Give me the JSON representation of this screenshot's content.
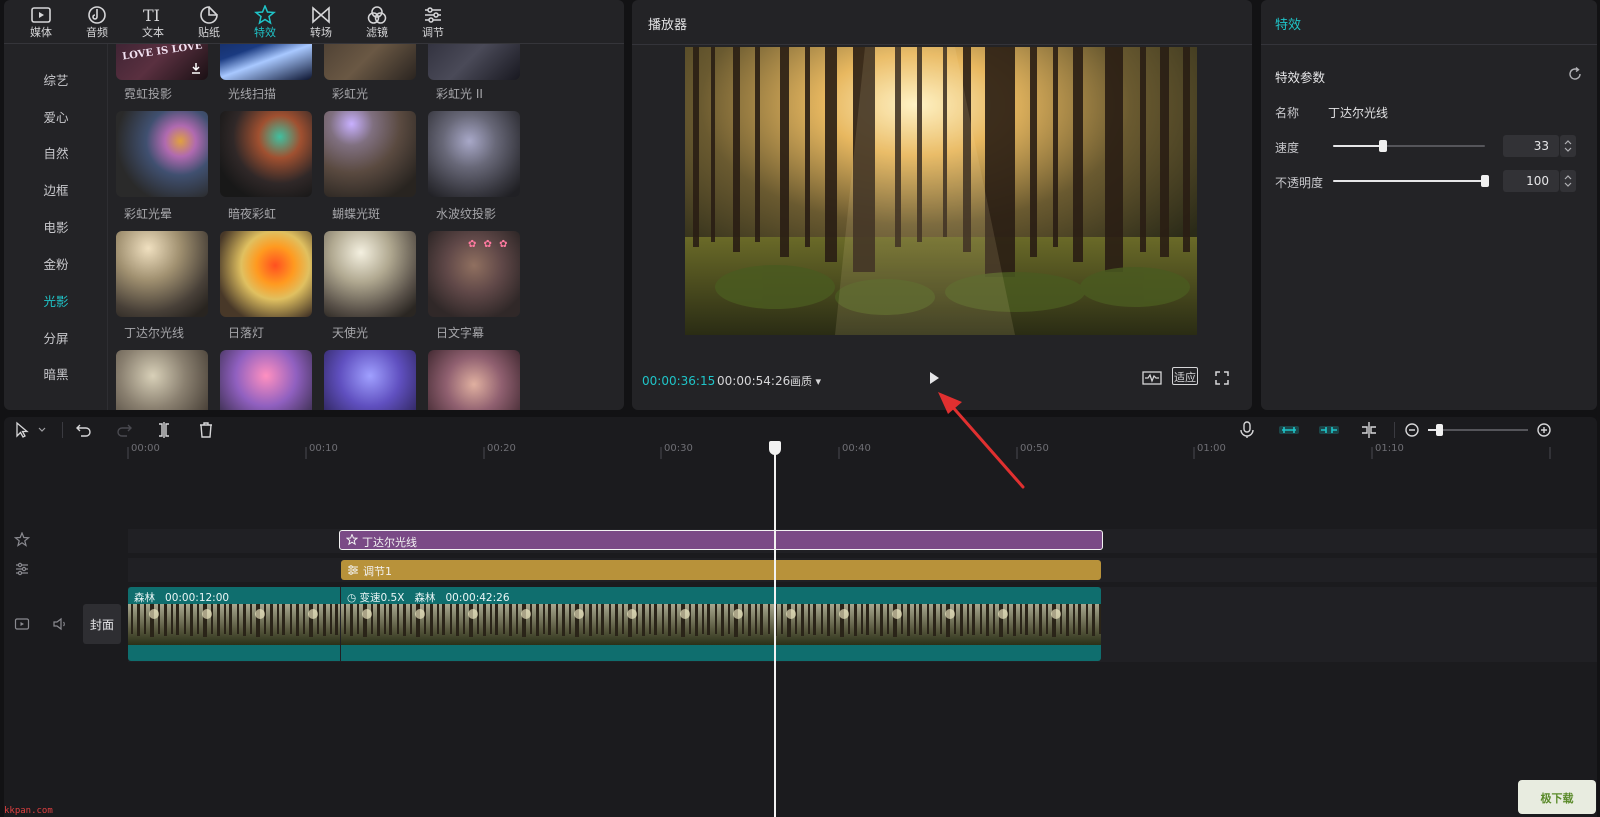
{
  "toolbar": {
    "items": [
      {
        "label": "媒体",
        "icon": "media-icon"
      },
      {
        "label": "音频",
        "icon": "audio-icon"
      },
      {
        "label": "文本",
        "icon": "text-icon"
      },
      {
        "label": "贴纸",
        "icon": "sticker-icon"
      },
      {
        "label": "特效",
        "icon": "effects-icon",
        "active": true
      },
      {
        "label": "转场",
        "icon": "transition-icon"
      },
      {
        "label": "滤镜",
        "icon": "filter-icon"
      },
      {
        "label": "调节",
        "icon": "adjust-icon"
      }
    ]
  },
  "categories": {
    "items": [
      "综艺",
      "爱心",
      "自然",
      "边框",
      "电影",
      "金粉",
      "光影",
      "分屏",
      "暗黑"
    ],
    "active": "光影"
  },
  "effects": {
    "tiles": [
      {
        "label": "霓虹投影",
        "thumb_text": "LOVE IS LOVE"
      },
      {
        "label": "光线扫描"
      },
      {
        "label": "彩虹光"
      },
      {
        "label": "彩虹光 II"
      },
      {
        "label": "彩虹光晕"
      },
      {
        "label": "暗夜彩虹"
      },
      {
        "label": "蝴蝶光斑"
      },
      {
        "label": "水波纹投影"
      },
      {
        "label": "丁达尔光线"
      },
      {
        "label": "日落灯"
      },
      {
        "label": "天使光"
      },
      {
        "label": "日文字幕"
      }
    ]
  },
  "player": {
    "title": "播放器",
    "current_time": "00:00:36:15",
    "duration": "00:00:54:26",
    "quality_label": "画质",
    "fit_label": "适应"
  },
  "fx_panel": {
    "title": "特效",
    "section": "特效参数",
    "name_label": "名称",
    "name_value": "丁达尔光线",
    "speed_label": "速度",
    "speed_value": "33",
    "speed_level": 0.33,
    "opacity_label": "不透明度",
    "opacity_value": "100",
    "opacity_level": 1.0
  },
  "timeline": {
    "ruler": [
      "00:00",
      "00:10",
      "00:20",
      "00:30",
      "00:40",
      "00:50",
      "01:00",
      "01:10"
    ],
    "fx_clip_label": "丁达尔光线",
    "adjust_clip_label": "调节1",
    "video_clip_1": {
      "name": "森林",
      "duration": "00:00:12:00"
    },
    "video_clip_2": {
      "speed": "变速0.5X",
      "name": "森林",
      "duration": "00:00:42:26"
    },
    "cover_label": "封面"
  },
  "watermarks": {
    "left": "kkpan.com",
    "right": "极下载"
  },
  "colors": {
    "accent": "#1fc4c8",
    "fx_clip": "#7a4a86",
    "adjust_clip": "#b8923a",
    "video_clip": "#0f6e6e",
    "annotation_arrow": "#e03030"
  }
}
